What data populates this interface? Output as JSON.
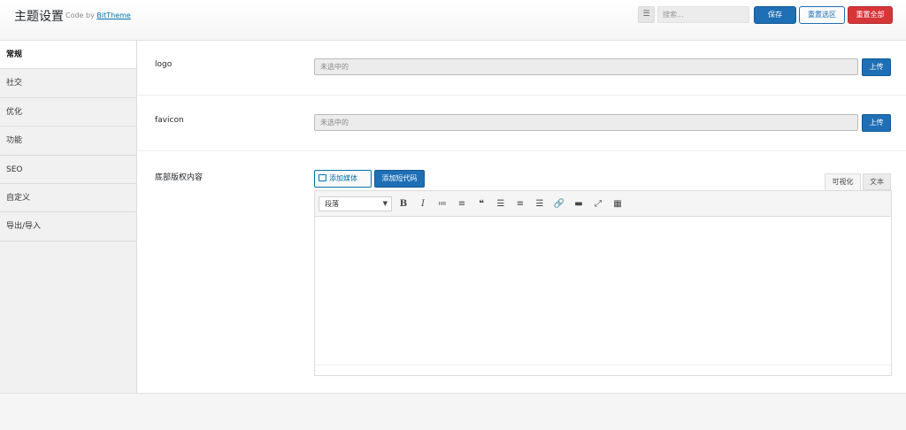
{
  "header": {
    "title": "主题设置",
    "code_by": "Code by",
    "brand_link": "BitTheme",
    "list_icon": "list-icon",
    "search_placeholder": "搜索...",
    "save_label": "保存",
    "reset_section_label": "重置选区",
    "reset_all_label": "重置全部"
  },
  "sidebar": {
    "items": [
      {
        "label": "常规"
      },
      {
        "label": "社交"
      },
      {
        "label": "优化"
      },
      {
        "label": "功能"
      },
      {
        "label": "SEO"
      },
      {
        "label": "自定义"
      },
      {
        "label": "导出/导入"
      }
    ],
    "active_index": 0
  },
  "fields": {
    "logo": {
      "label": "logo",
      "value": "未选中的",
      "button": "上传"
    },
    "favicon": {
      "label": "favicon",
      "value": "未选中的",
      "button": "上传"
    },
    "footer": {
      "label": "底部版权内容",
      "add_media": "添加媒体",
      "add_shortcode": "添加短代码",
      "tab_visual": "可视化",
      "tab_text": "文本",
      "format_value": "段落",
      "tools": [
        "bold",
        "italic",
        "bullet-list",
        "numbered-list",
        "blockquote",
        "align-left",
        "align-center",
        "align-right",
        "link",
        "read-more",
        "fullscreen",
        "toolbar-toggle"
      ],
      "content": ""
    }
  },
  "colors": {
    "primary": "#1e6fb5",
    "danger": "#d63638",
    "link": "#0073aa"
  }
}
